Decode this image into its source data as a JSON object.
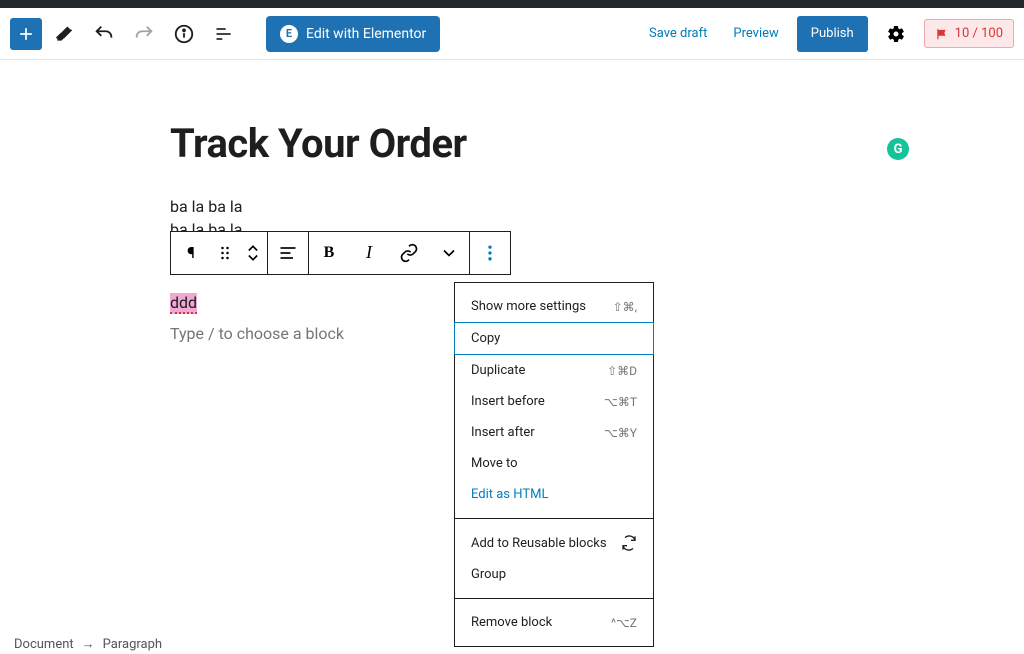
{
  "toolbar": {
    "elementor_label": "Edit with Elementor",
    "save_draft": "Save draft",
    "preview": "Preview",
    "publish": "Publish",
    "score": "10 / 100"
  },
  "page": {
    "title": "Track Your Order",
    "line1": "ba la ba la",
    "line2": "ba la ba la",
    "selected": "ddd",
    "placeholder": "Type / to choose a block"
  },
  "menu": {
    "show_more": "Show more settings",
    "show_more_key": "⇧⌘,",
    "copy": "Copy",
    "duplicate": "Duplicate",
    "duplicate_key": "⇧⌘D",
    "insert_before": "Insert before",
    "insert_before_key": "⌥⌘T",
    "insert_after": "Insert after",
    "insert_after_key": "⌥⌘Y",
    "move_to": "Move to",
    "edit_html": "Edit as HTML",
    "reusable": "Add to Reusable blocks",
    "group": "Group",
    "remove": "Remove block",
    "remove_key": "^⌥Z"
  },
  "breadcrumb": {
    "root": "Document",
    "current": "Paragraph"
  },
  "grammarly_letter": "G"
}
